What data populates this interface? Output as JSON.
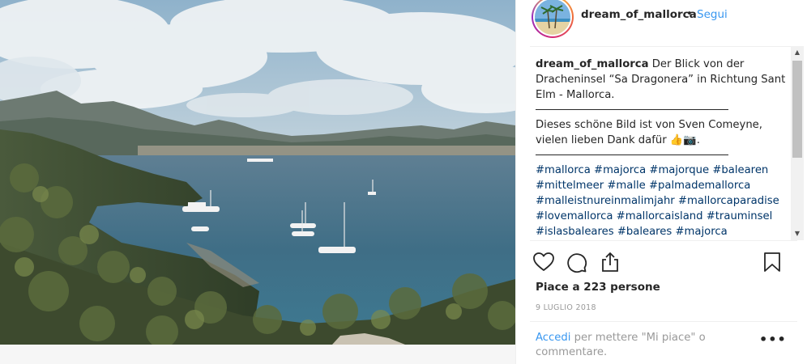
{
  "post": {
    "username": "dream_of_mallorca",
    "separator_dot": "•",
    "follow_label": "Segui",
    "caption": {
      "username": "dream_of_mallorca",
      "text": "Der Blick von der Dracheninsel “Sa Dragonera” in Richtung Sant Elm - Mallorca.",
      "credit": "Dieses schöne Bild ist von Sven Comeyne, vielen lieben Dank dafür 👍📷.",
      "hashtags": "#mallorca #majorca #majorque #balearen #mittelmeer #malle #palmademallorca #malleistnureinmalimjahr #mallorcaparadise #lovemallorca #mallorcaisland #trauminsel #islasbaleares #baleares #majorca"
    },
    "likes_text": "Piace a 223 persone",
    "date": "9 LUGLIO 2018",
    "login_link": "Accedi",
    "login_rest": " per mettere \"Mi piace\" o commentare.",
    "more_label": "•••",
    "scroll_up": "▲",
    "scroll_down": "▼"
  },
  "icons": {
    "like": "heart-icon",
    "comment": "comment-icon",
    "share": "share-icon",
    "save": "bookmark-icon"
  },
  "colors": {
    "link_blue": "#3897f0",
    "hashtag_blue": "#003569",
    "text": "#262626",
    "muted": "#999999"
  }
}
